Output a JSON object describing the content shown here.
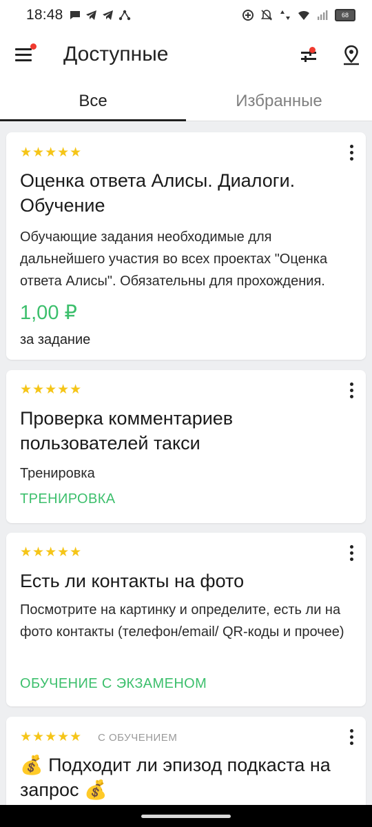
{
  "status_bar": {
    "time": "18:48",
    "left_icons": [
      "chat-bubble-icon",
      "telegram-icon",
      "telegram-icon",
      "network-share-icon"
    ],
    "right_icons": [
      "data-saver-icon",
      "alarm-off-icon",
      "wifi-data-icon",
      "wifi-icon",
      "signal-icon",
      "battery-icon"
    ],
    "battery_level": "68"
  },
  "app_bar": {
    "title": "Доступные",
    "menu_has_notification": true,
    "filter_has_notification": true
  },
  "tabs": [
    {
      "label": "Все",
      "active": true
    },
    {
      "label": "Избранные",
      "active": false
    }
  ],
  "colors": {
    "accent_green": "#3cbf6c",
    "star_yellow": "#f5c518",
    "notification_red": "#f03a2f"
  },
  "tasks": [
    {
      "stars": "★★★★★",
      "title": "Оценка ответа Алисы. Диалоги. Обучение",
      "description": "Обучающие задания необходимые для дальнейшего участия во всех проектах \"Оценка ответа Алисы\". Обязательны для прохождения.",
      "price": "1,00 ₽",
      "price_unit": "за задание"
    },
    {
      "stars": "★★★★★",
      "title": "Проверка комментариев пользователей такси",
      "description": "Тренировка",
      "tag": "ТРЕНИРОВКА"
    },
    {
      "stars": "★★★★★",
      "title": "Есть ли контакты на фото",
      "description": "Посмотрите на картинку и определите, есть ли на фото контакты (телефон/email/ QR-коды и прочее)",
      "tag": "ОБУЧЕНИЕ С ЭКЗАМЕНОМ"
    },
    {
      "stars": "★★★★★",
      "badge": "С ОБУЧЕНИЕМ",
      "title": "💰 Подходит ли эпизод подкаста на запрос 💰"
    }
  ]
}
